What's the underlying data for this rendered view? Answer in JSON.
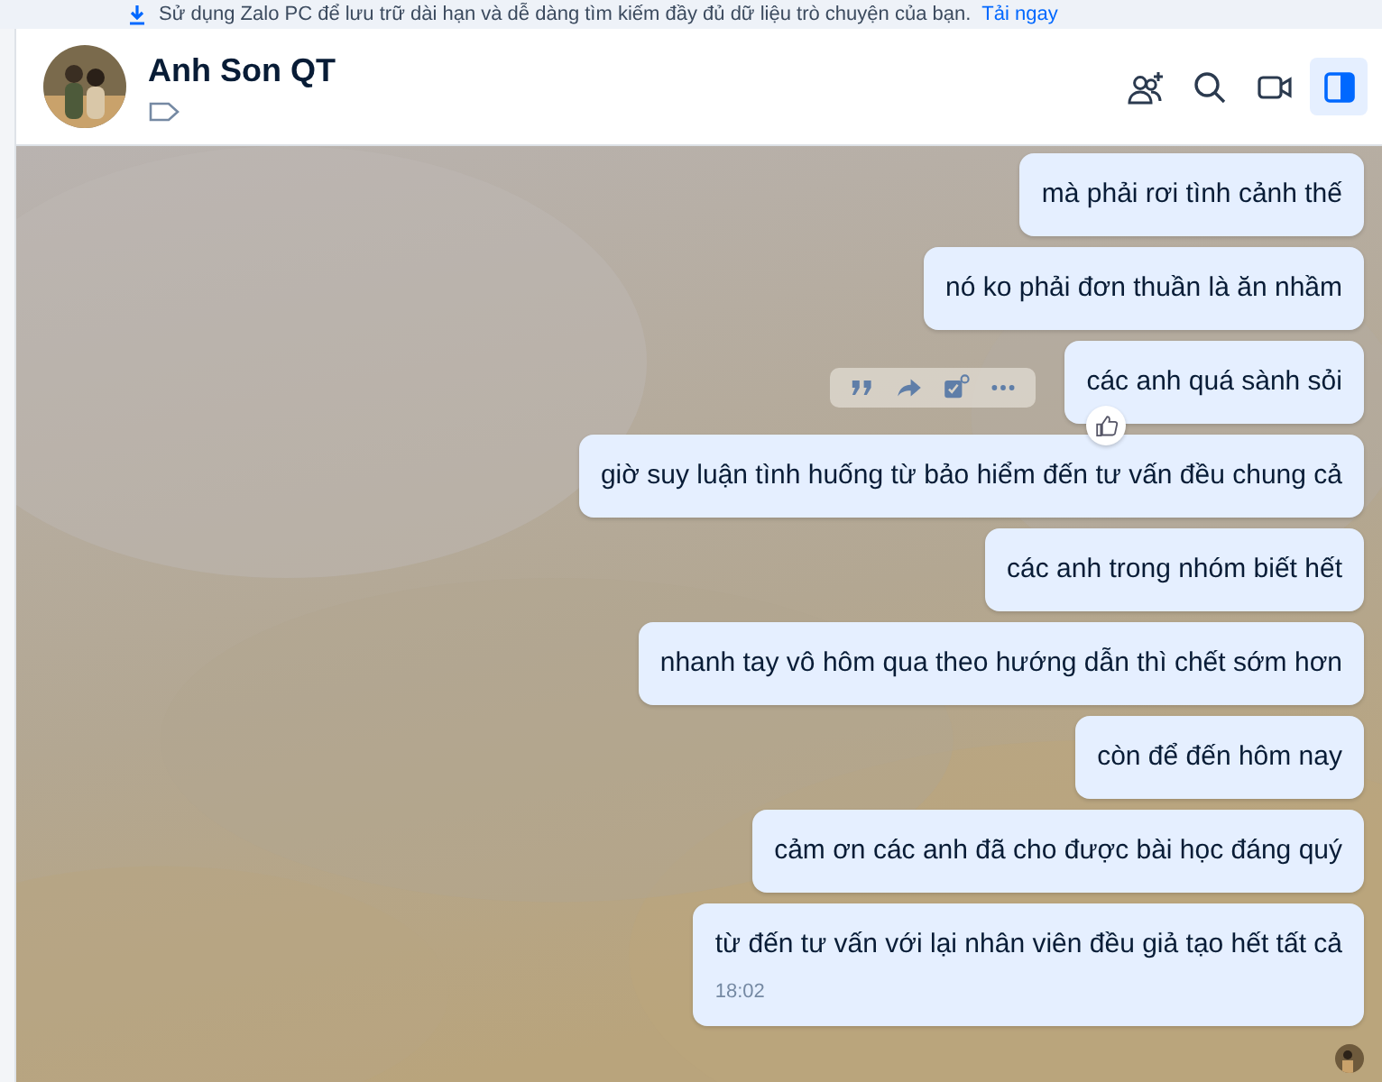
{
  "banner": {
    "text": "Sử dụng Zalo PC để lưu trữ dài hạn và dễ dàng tìm kiếm đầy đủ dữ liệu trò chuyện của bạn.",
    "link": "Tải ngay"
  },
  "header": {
    "name": "Anh Son QT",
    "actions": [
      {
        "kind": "add-member",
        "selected": false
      },
      {
        "kind": "search",
        "selected": false
      },
      {
        "kind": "video",
        "selected": false
      },
      {
        "kind": "panel",
        "selected": true
      }
    ]
  },
  "messages": [
    {
      "text": "mà phải rơi tình cảnh thế",
      "hovered": false
    },
    {
      "text": "nó ko phải đơn thuần là ăn nhầm",
      "hovered": false
    },
    {
      "text": "các anh quá sành sỏi",
      "hovered": true
    },
    {
      "text": "giờ suy luận tình huống từ bảo hiểm đến tư vấn đều chung cả",
      "hovered": false
    },
    {
      "text": "các anh trong nhóm biết hết",
      "hovered": false
    },
    {
      "text": "nhanh tay vô hôm qua theo hướng dẫn thì chết sớm hơn",
      "hovered": false
    },
    {
      "text": "còn để đến hôm nay",
      "hovered": false
    },
    {
      "text": "cảm ơn các anh đã cho được bài học đáng quý",
      "hovered": false
    },
    {
      "text": "từ đến tư vấn với lại nhân viên đều giả tạo hết tất cả",
      "time": "18:02",
      "hovered": false,
      "seen": true
    }
  ]
}
